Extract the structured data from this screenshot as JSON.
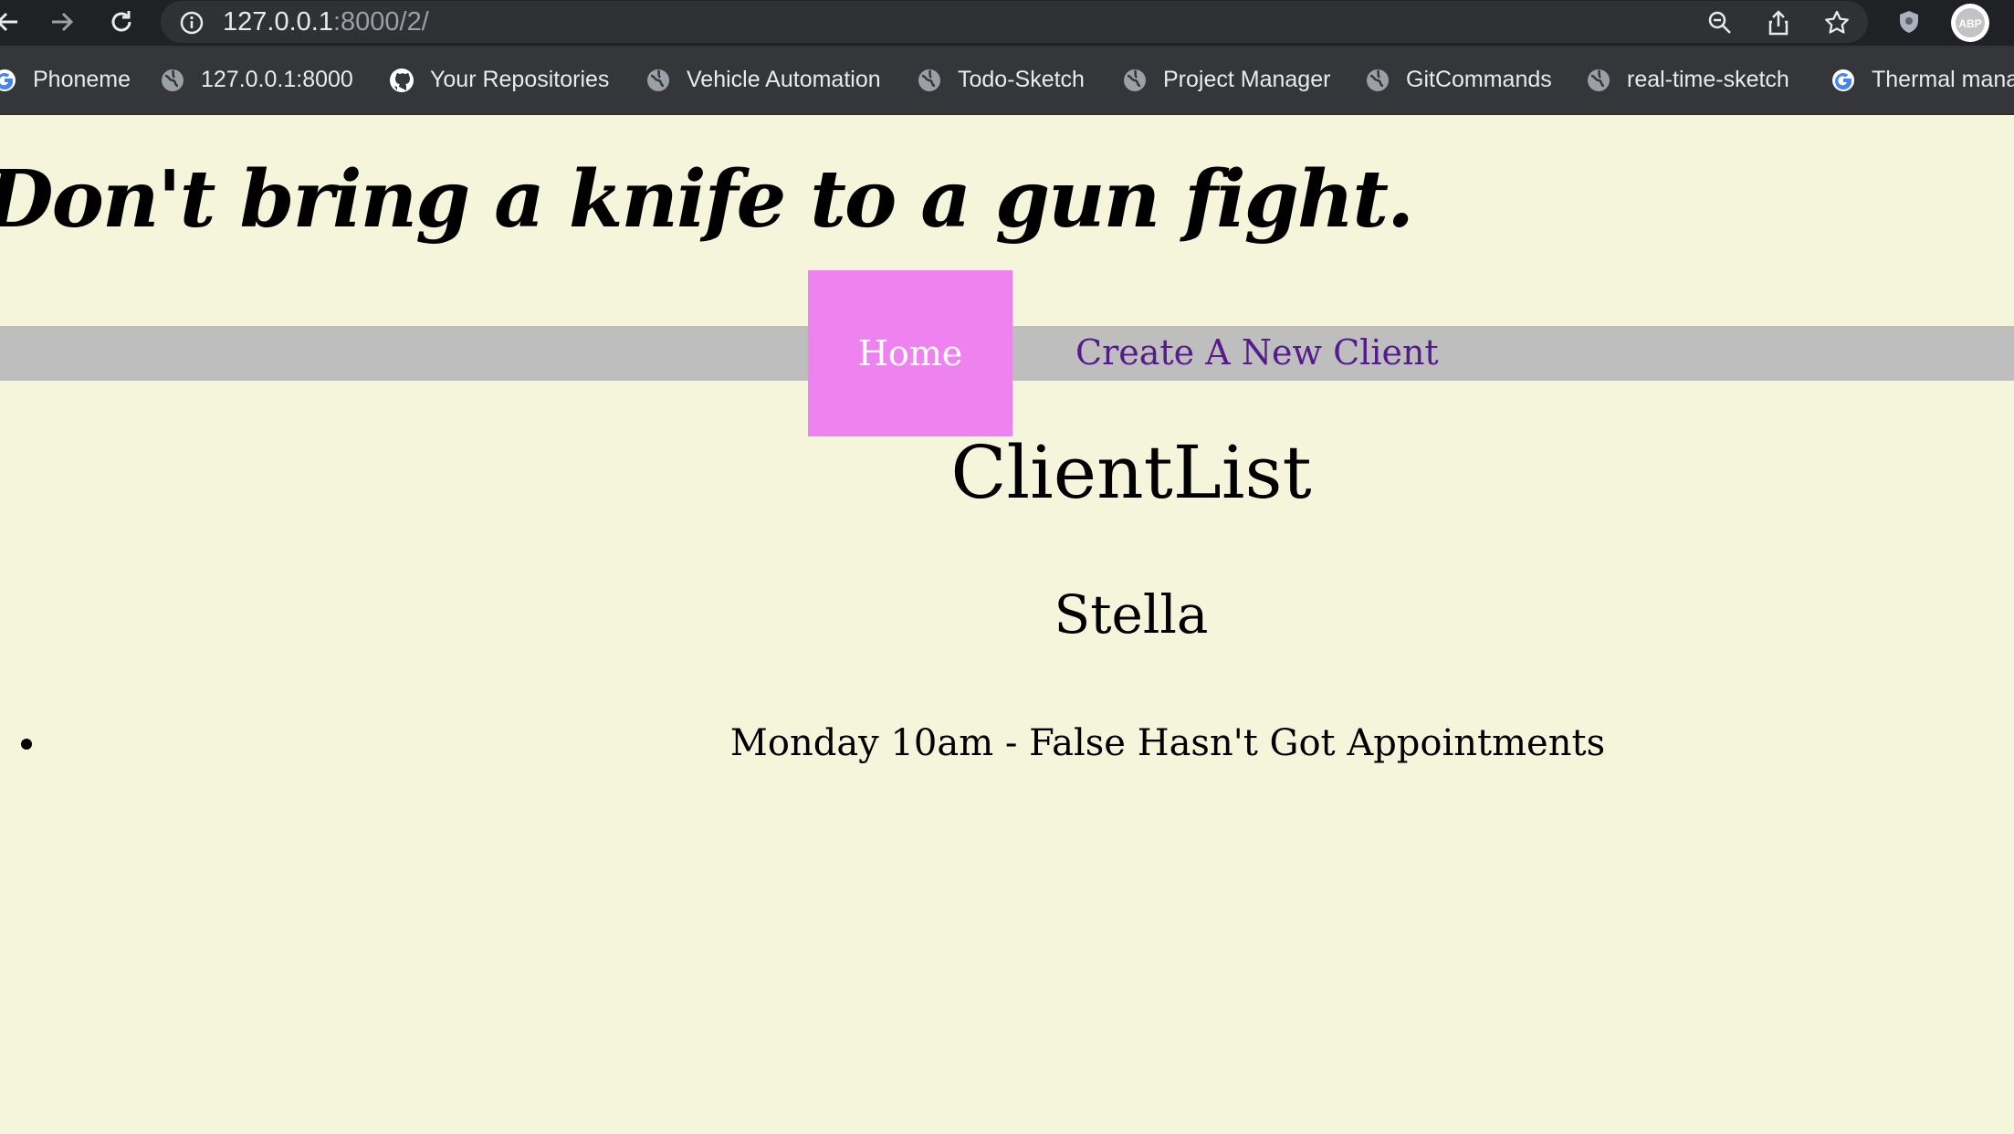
{
  "browser": {
    "url_host": "127.0.0.1",
    "url_path": ":8000/2/",
    "bookmarks": [
      {
        "label": "Phoneme",
        "icon": "google-icon"
      },
      {
        "label": "127.0.0.1:8000",
        "icon": "globe-icon"
      },
      {
        "label": "Your Repositories",
        "icon": "github-icon"
      },
      {
        "label": "Vehicle Automation",
        "icon": "globe-icon"
      },
      {
        "label": "Todo-Sketch",
        "icon": "globe-icon"
      },
      {
        "label": "Project Manager",
        "icon": "globe-icon"
      },
      {
        "label": "GitCommands",
        "icon": "globe-icon"
      },
      {
        "label": "real-time-sketch",
        "icon": "globe-icon"
      },
      {
        "label": "Thermal mana",
        "icon": "google-icon"
      }
    ],
    "profile_badge": "ABP"
  },
  "page": {
    "hero_text": "Don't bring a knife to a gun fight.",
    "nav": {
      "home_label": "Home",
      "create_label": "Create A New Client"
    },
    "title": "ClientList",
    "client_name": "Stella",
    "appointments": [
      "Monday 10am - False Hasn't Got Appointments"
    ]
  },
  "colors": {
    "background": "#f5f5dc",
    "navbar": "#bebebe",
    "home_button": "#ee82ee",
    "link": "#551a8b"
  }
}
